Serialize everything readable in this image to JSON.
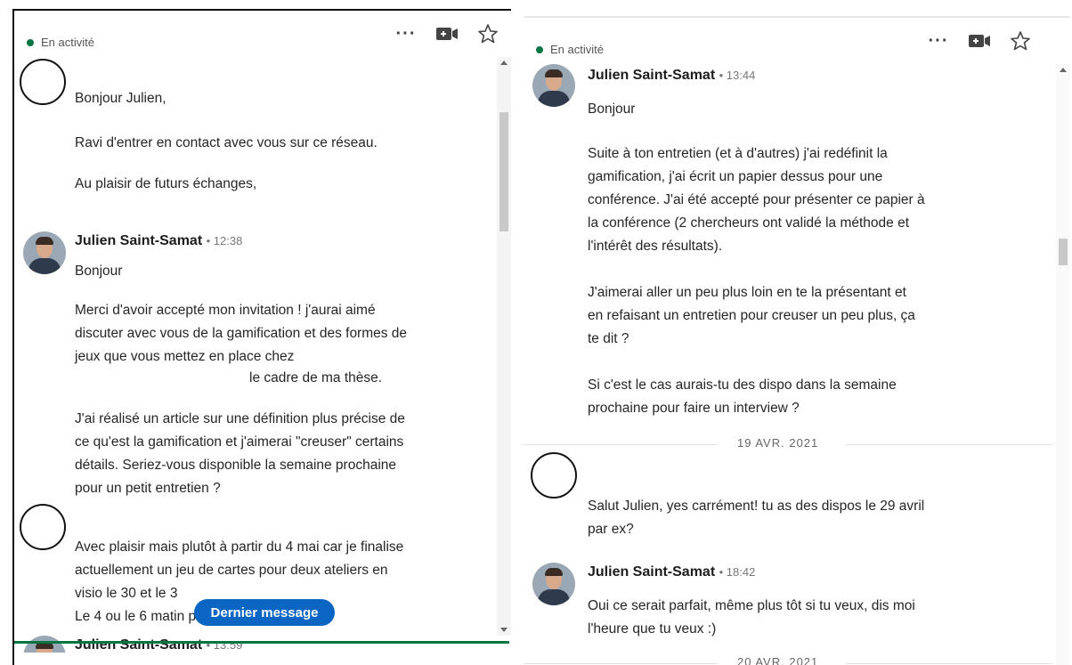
{
  "colors": {
    "accent": "#0a66c2",
    "online": "#057642",
    "compose_bar": "#057642"
  },
  "left": {
    "status": "En activité",
    "messages": {
      "m1": {
        "p1": "Bonjour Julien,",
        "p2": "Ravi d'entrer en contact avec vous sur ce réseau.",
        "p3": "Au plaisir de futurs échanges,"
      },
      "m2": {
        "sender": "Julien Saint-Samat",
        "time": "• 12:38",
        "p1": "Bonjour",
        "p2": "Merci d'avoir accepté mon invitation ! j'aurai aimé\ndiscuter avec vous de la gamification et des formes de\njeux que vous mettez en place chez",
        "p3": "le cadre de ma thèse.",
        "p4": "J'ai réalisé un article sur une définition plus précise de\nce qu'est la gamification et j'aimerai \"creuser\" certains\ndétails. Seriez-vous disponible la semaine prochaine\npour un petit entretien ?"
      },
      "m3": {
        "p1": "Avec plaisir mais plutôt à partir du 4 mai car je finalise\nactuellement un jeu de cartes pour deux ateliers en\nvisio le 30 et le 3\nLe 4 ou le 6 matin par exemple"
      },
      "m4": {
        "sender": "Julien Saint-Samat",
        "time": "• 13:59"
      }
    },
    "last_message_button": "Dernier message"
  },
  "right": {
    "status": "En activité",
    "messages": {
      "m1": {
        "sender": "Julien Saint-Samat",
        "time": "• 13:44",
        "p1": "Bonjour",
        "p2": "Suite à ton entretien (et à d'autres) j'ai redéfinit la\ngamification, j'ai écrit un papier dessus pour une\nconférence. J'ai été accepté pour présenter ce papier à\nla conférence (2 chercheurs ont validé la méthode et\nl'intérêt des résultats).",
        "p3": "J'aimerai aller un peu plus loin en te la présentant et\nen refaisant un entretien pour creuser un peu plus, ça\nte dit ?",
        "p4": "Si c'est le cas aurais-tu des dispo dans la semaine\nprochaine pour faire un interview ?"
      },
      "date1": "19 AVR. 2021",
      "m2": {
        "p1": "Salut Julien, yes carrément! tu as des dispos le 29 avril\npar ex?"
      },
      "m3": {
        "sender": "Julien Saint-Samat",
        "time": "• 18:42",
        "p1": "Oui ce serait parfait, même plus tôt si tu veux, dis moi\nl'heure que tu veux :)"
      },
      "date2": "20 AVR. 2021"
    }
  },
  "icons": {
    "more": "more-icon",
    "video": "video-call-icon",
    "star": "star-icon"
  }
}
